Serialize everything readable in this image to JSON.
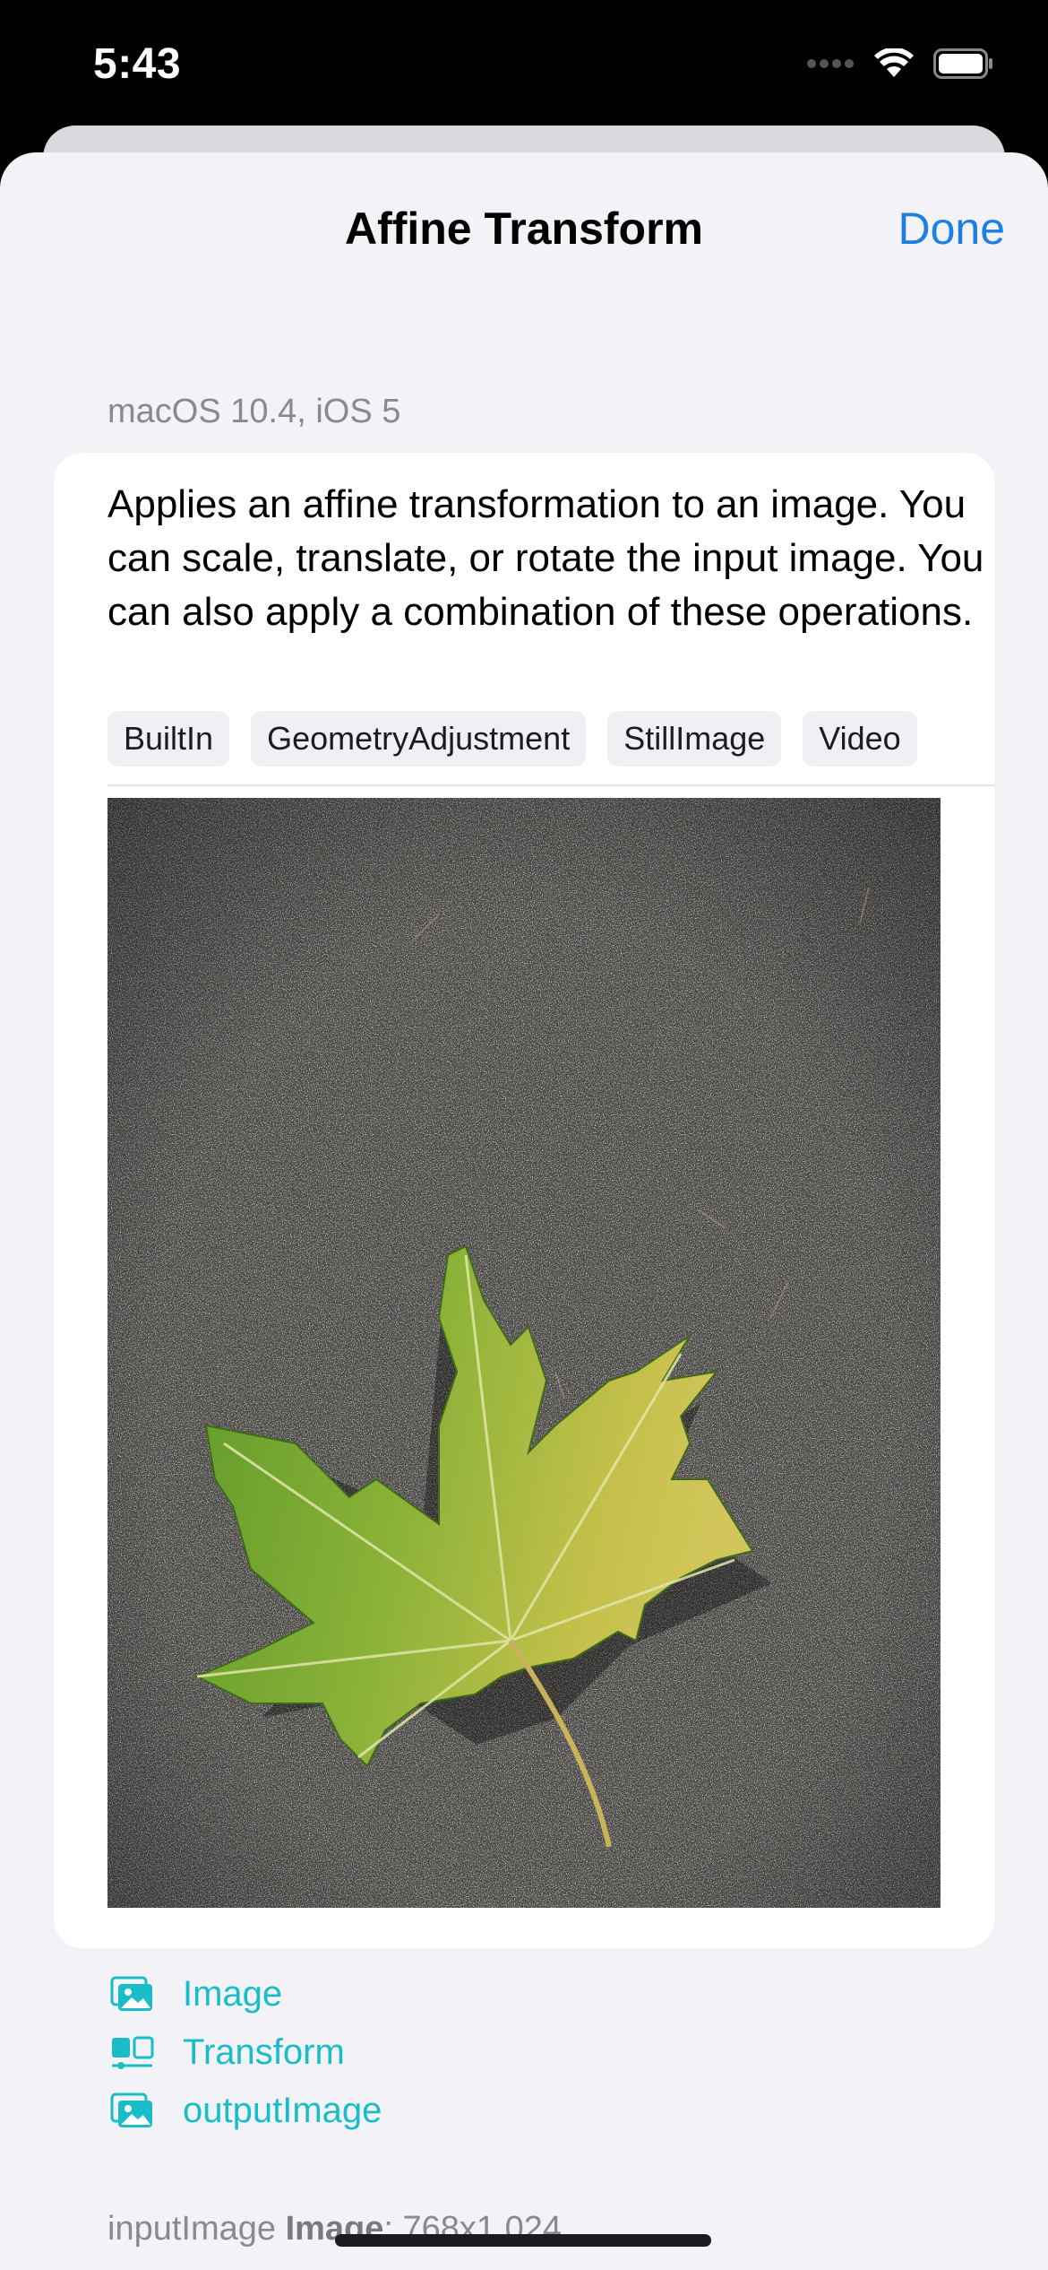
{
  "status": {
    "time": "5:43"
  },
  "nav": {
    "title": "Affine Transform",
    "done_label": "Done"
  },
  "availability": "macOS 10.4, iOS 5",
  "description": "Applies an affine transformation to an image. You can scale, translate, or rotate the input image. You can also apply a combination of these operations.",
  "tags": [
    "BuiltIn",
    "GeometryAdjustment",
    "StillImage",
    "Video"
  ],
  "links": [
    {
      "label": "Image",
      "icon": "photo-stack-icon"
    },
    {
      "label": "Transform",
      "icon": "transform-icon"
    },
    {
      "label": "outputImage",
      "icon": "photo-stack-icon"
    }
  ],
  "footer": {
    "param": "inputImage",
    "type": "Image",
    "value": ": 768x1,024"
  },
  "colors": {
    "accent": "#1e7fe3",
    "link": "#19bdc8",
    "background": "#f2f2f7"
  }
}
